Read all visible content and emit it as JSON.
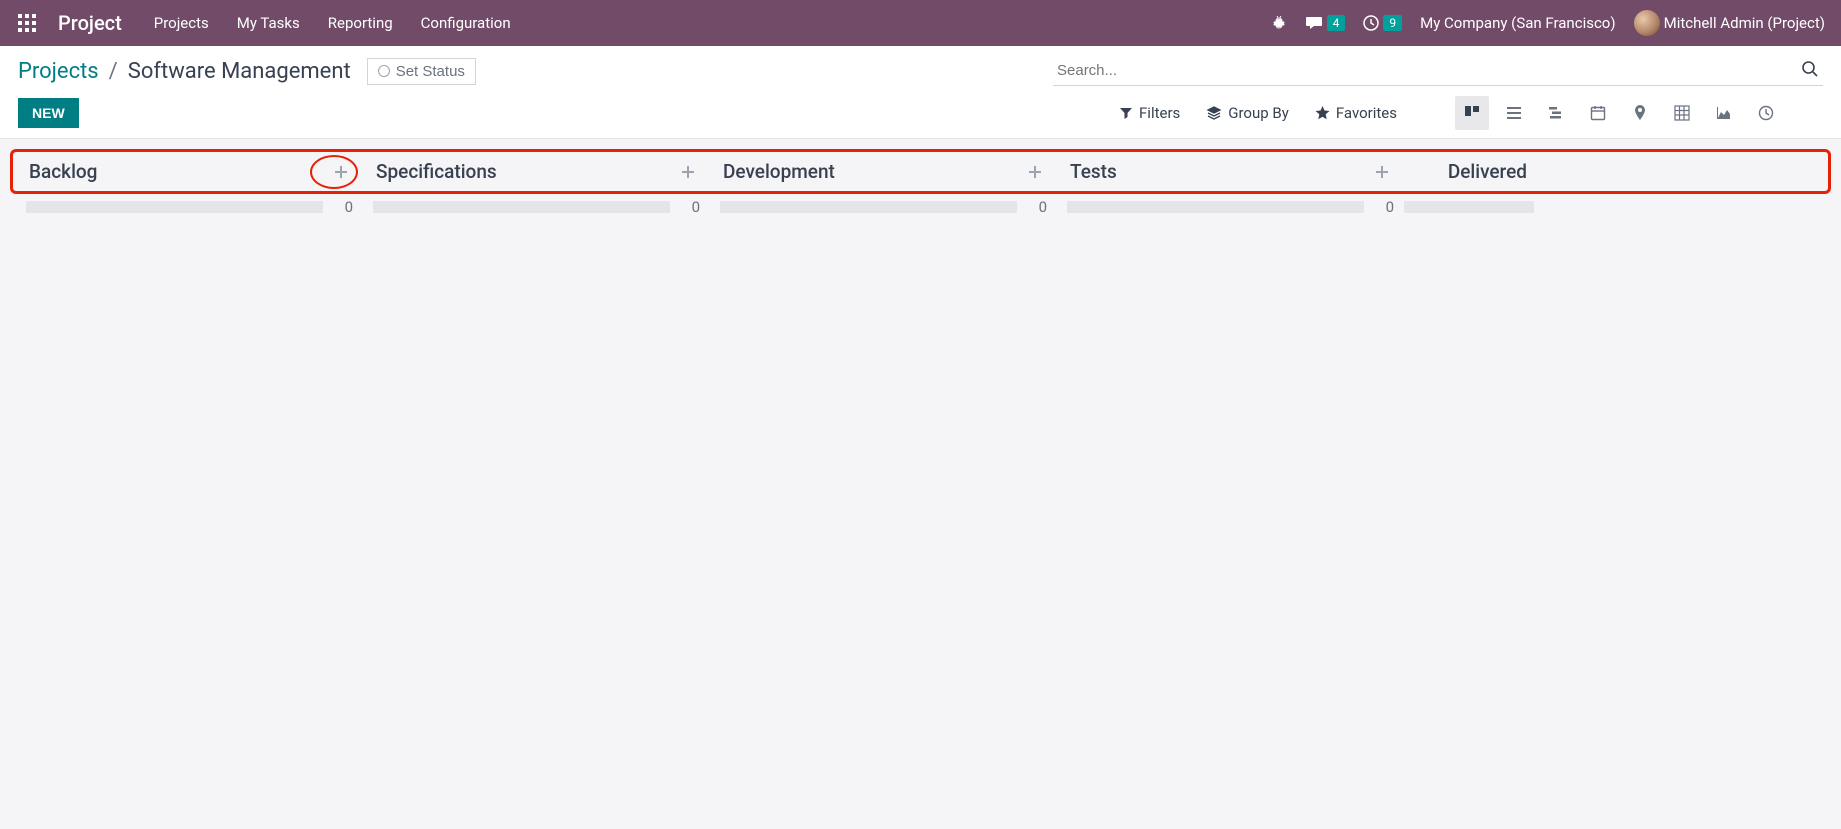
{
  "topnav": {
    "brand": "Project",
    "menu": [
      "Projects",
      "My Tasks",
      "Reporting",
      "Configuration"
    ],
    "messages_badge": "4",
    "activities_badge": "9",
    "company": "My Company (San Francisco)",
    "user": "Mitchell Admin (Project)"
  },
  "control": {
    "breadcrumb_link": "Projects",
    "breadcrumb_sep": "/",
    "breadcrumb_current": "Software Management",
    "set_status": "Set Status",
    "search_placeholder": "Search...",
    "new_button": "NEW",
    "filters": "Filters",
    "group_by": "Group By",
    "favorites": "Favorites"
  },
  "stages": [
    {
      "title": "Backlog",
      "count": "0"
    },
    {
      "title": "Specifications",
      "count": "0"
    },
    {
      "title": "Development",
      "count": "0"
    },
    {
      "title": "Tests",
      "count": "0"
    },
    {
      "title": "Delivered",
      "count": ""
    }
  ]
}
